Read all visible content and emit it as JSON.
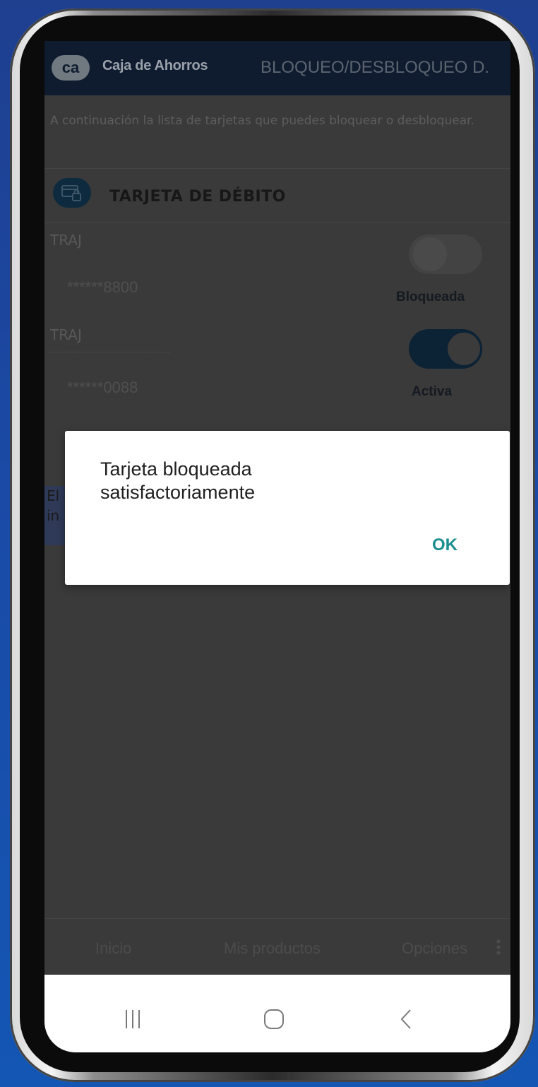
{
  "header": {
    "logo_text": "ca",
    "brand": "Caja de Ahorros",
    "title": "BLOQUEO/DESBLOQUEO D."
  },
  "intro_text": "A continuación la lista de tarjetas que puedes bloquear o desbloquear.",
  "section": {
    "icon": "card-lock-icon",
    "title": "TARJETA DE DÉBITO"
  },
  "cards": [
    {
      "label": "TRAJ",
      "number": "******8800",
      "status": "Bloqueada",
      "toggle_on": false
    },
    {
      "label": "TRAJ",
      "number": "******0088",
      "status": "Activa",
      "toggle_on": true
    }
  ],
  "under_note": [
    "El",
    "in"
  ],
  "dialog": {
    "message": "Tarjeta bloqueada satisfactoriamente",
    "ok_label": "OK"
  },
  "bottom_nav": {
    "home": "Inicio",
    "products": "Mis productos",
    "options": "Opciones",
    "options_icon": "more-vertical-icon"
  },
  "system_nav": {
    "recents_icon": "recents-icon",
    "home_icon": "home-icon",
    "back_icon": "back-icon"
  },
  "colors": {
    "header_bg": "#0f1c2f",
    "accent": "#1b8f8f",
    "dim_screen": "#3a3a3a",
    "background": "#1a4aa6"
  }
}
